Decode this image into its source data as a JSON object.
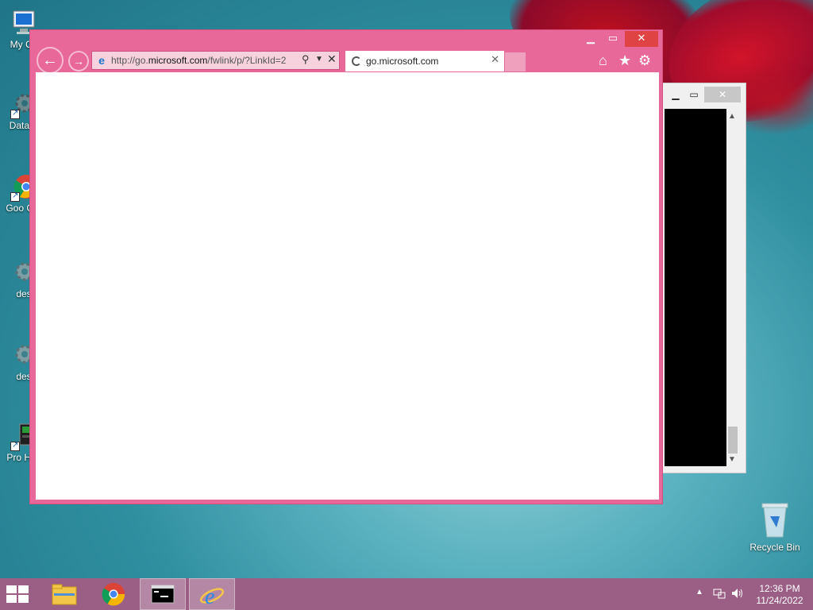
{
  "desktop": {
    "icons": [
      {
        "label": "My Co",
        "icon": "computer-icon"
      },
      {
        "label": "DataW",
        "icon": "gear-icon"
      },
      {
        "label": "Goo Chr",
        "icon": "chrome-icon"
      },
      {
        "label": "des",
        "icon": "gear-icon"
      },
      {
        "label": "des",
        "icon": "gear-icon"
      },
      {
        "label": "Pro Hac",
        "icon": "application-icon"
      }
    ],
    "recycle_bin": "Recycle Bin"
  },
  "browser": {
    "address": {
      "url_prefix": "http://go.",
      "url_domain": "microsoft.com",
      "url_rest": "/fwlink/p/?LinkId=2"
    },
    "tab": {
      "title": "go.microsoft.com"
    }
  },
  "taskbar": {
    "clock": {
      "time": "12:36 PM",
      "date": "11/24/2022"
    }
  },
  "colors": {
    "ie_frame": "#e8689a",
    "taskbar": "#9b5f86",
    "close_button": "#e04343"
  }
}
